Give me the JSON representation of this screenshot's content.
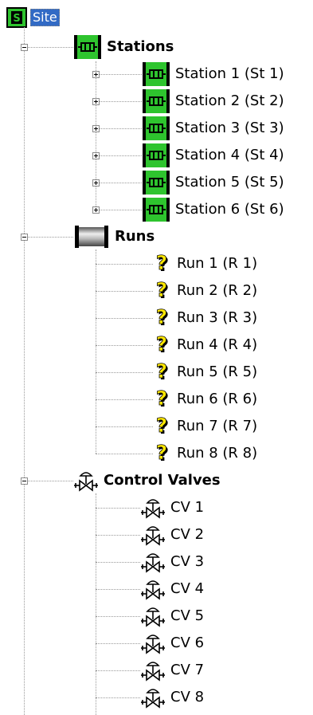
{
  "root": {
    "label": "Site",
    "icon": "site-icon"
  },
  "stations": {
    "label": "Stations",
    "icon": "station-icon",
    "items": [
      {
        "label": "Station 1 (St 1)"
      },
      {
        "label": "Station 2 (St 2)"
      },
      {
        "label": "Station 3 (St 3)"
      },
      {
        "label": "Station 4 (St 4)"
      },
      {
        "label": "Station 5 (St 5)"
      },
      {
        "label": "Station 6 (St 6)"
      }
    ]
  },
  "runs": {
    "label": "Runs",
    "icon": "pipe-icon",
    "items": [
      {
        "label": "Run 1 (R 1)"
      },
      {
        "label": "Run 2 (R 2)"
      },
      {
        "label": "Run 3 (R 3)"
      },
      {
        "label": "Run 4 (R 4)"
      },
      {
        "label": "Run 5 (R 5)"
      },
      {
        "label": "Run 6 (R 6)"
      },
      {
        "label": "Run 7 (R 7)"
      },
      {
        "label": "Run 8 (R 8)"
      }
    ]
  },
  "control_valves": {
    "label": "Control Valves",
    "icon": "valve-icon",
    "items": [
      {
        "label": "CV 1"
      },
      {
        "label": "CV 2"
      },
      {
        "label": "CV 3"
      },
      {
        "label": "CV 4"
      },
      {
        "label": "CV 5"
      },
      {
        "label": "CV 6"
      },
      {
        "label": "CV 7"
      },
      {
        "label": "CV 8"
      }
    ]
  },
  "colors": {
    "station_green": "#2ec42e",
    "selection_blue": "#316ac5",
    "unknown_yellow": "#ffe800"
  }
}
